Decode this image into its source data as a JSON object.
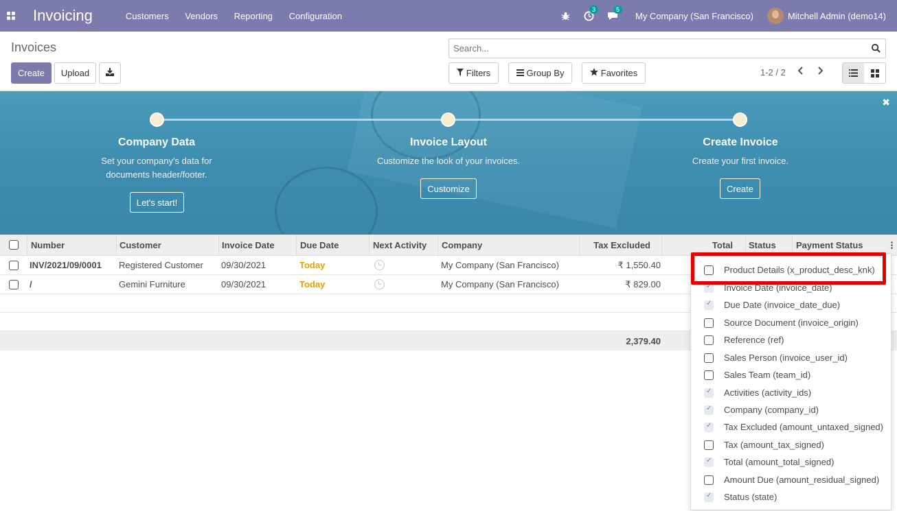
{
  "navbar": {
    "app_title": "Invoicing",
    "menu": [
      "Customers",
      "Vendors",
      "Reporting",
      "Configuration"
    ],
    "activity_count": "3",
    "message_count": "5",
    "company": "My Company (San Francisco)",
    "user": "Mitchell Admin (demo14)"
  },
  "control_panel": {
    "title": "Invoices",
    "create_label": "Create",
    "upload_label": "Upload",
    "search_placeholder": "Search...",
    "filters_label": "Filters",
    "groupby_label": "Group By",
    "favorites_label": "Favorites",
    "pager": "1-2 / 2"
  },
  "banner": {
    "steps": [
      {
        "title": "Company Data",
        "desc_line1": "Set your company's data for",
        "desc_line2": "documents header/footer.",
        "button": "Let's start!"
      },
      {
        "title": "Invoice Layout",
        "desc_line1": "Customize the look of your invoices.",
        "desc_line2": "",
        "button": "Customize"
      },
      {
        "title": "Create Invoice",
        "desc_line1": "Create your first invoice.",
        "desc_line2": "",
        "button": "Create"
      }
    ]
  },
  "table": {
    "headers": {
      "number": "Number",
      "customer": "Customer",
      "invoice_date": "Invoice Date",
      "due_date": "Due Date",
      "next_activity": "Next Activity",
      "company": "Company",
      "tax_excluded": "Tax Excluded",
      "total": "Total",
      "status": "Status",
      "payment_status": "Payment Status"
    },
    "rows": [
      {
        "number": "INV/2021/09/0001",
        "customer": "Registered Customer",
        "invoice_date": "09/30/2021",
        "due_date": "Today",
        "company": "My Company (San Francisco)",
        "tax_excluded": "₹ 1,550.40"
      },
      {
        "number": "/",
        "customer": "Gemini Furniture",
        "invoice_date": "09/30/2021",
        "due_date": "Today",
        "company": "My Company (San Francisco)",
        "tax_excluded": "₹ 829.00"
      }
    ],
    "footer_total": "2,379.40"
  },
  "optional_columns": [
    {
      "label": "Product Details (x_product_desc_knk)",
      "checked": false
    },
    {
      "label": "Invoice Date (invoice_date)",
      "checked": true
    },
    {
      "label": "Due Date (invoice_date_due)",
      "checked": true
    },
    {
      "label": "Source Document (invoice_origin)",
      "checked": false
    },
    {
      "label": "Reference (ref)",
      "checked": false
    },
    {
      "label": "Sales Person (invoice_user_id)",
      "checked": false
    },
    {
      "label": "Sales Team (team_id)",
      "checked": false
    },
    {
      "label": "Activities (activity_ids)",
      "checked": true
    },
    {
      "label": "Company (company_id)",
      "checked": true
    },
    {
      "label": "Tax Excluded (amount_untaxed_signed)",
      "checked": true
    },
    {
      "label": "Tax (amount_tax_signed)",
      "checked": false
    },
    {
      "label": "Total (amount_total_signed)",
      "checked": true
    },
    {
      "label": "Amount Due (amount_residual_signed)",
      "checked": false
    },
    {
      "label": "Status (state)",
      "checked": true
    }
  ]
}
